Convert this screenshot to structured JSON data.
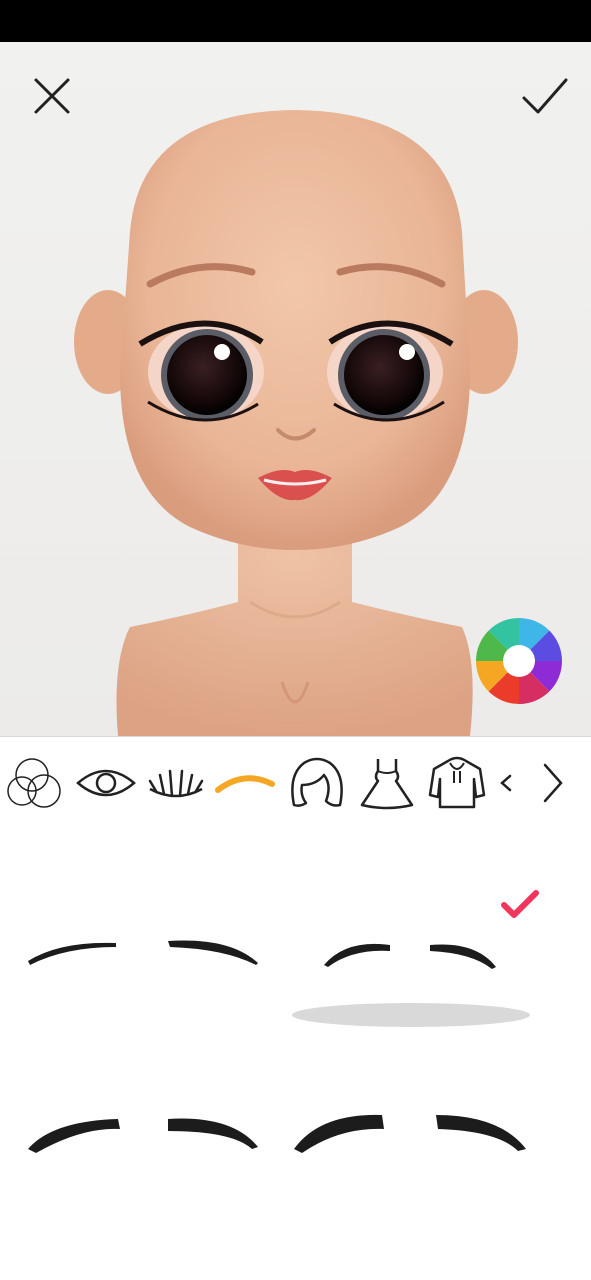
{
  "app": {
    "screen": "eyebrow-editor"
  },
  "header": {
    "close_icon": "close-icon",
    "confirm_icon": "checkmark-icon",
    "color_picker_icon": "color-wheel-icon"
  },
  "toolbar": {
    "tabs": [
      {
        "icon": "skin-tone-icon",
        "selected": false
      },
      {
        "icon": "eye-icon",
        "selected": false
      },
      {
        "icon": "eyelashes-icon",
        "selected": false
      },
      {
        "icon": "eyebrow-icon",
        "selected": true
      },
      {
        "icon": "hair-icon",
        "selected": false
      },
      {
        "icon": "dress-icon",
        "selected": false
      },
      {
        "icon": "hoodie-icon",
        "selected": false
      },
      {
        "icon": "chevron-left-icon",
        "selected": false
      },
      {
        "icon": "chevron-right-icon",
        "selected": false
      }
    ],
    "accent_color": "#f5a623"
  },
  "options": {
    "selected_index": 1,
    "selected_marker_icon": "checkmark-icon",
    "selected_marker_color": "#f0365a",
    "items": [
      {
        "style": "thin-straight"
      },
      {
        "style": "thin-arched"
      },
      {
        "style": "thick-feathered"
      },
      {
        "style": "thick-arched"
      }
    ]
  },
  "colors": {
    "skin": "#e9b596",
    "lip": "#d9504f",
    "brow": "#222222"
  }
}
